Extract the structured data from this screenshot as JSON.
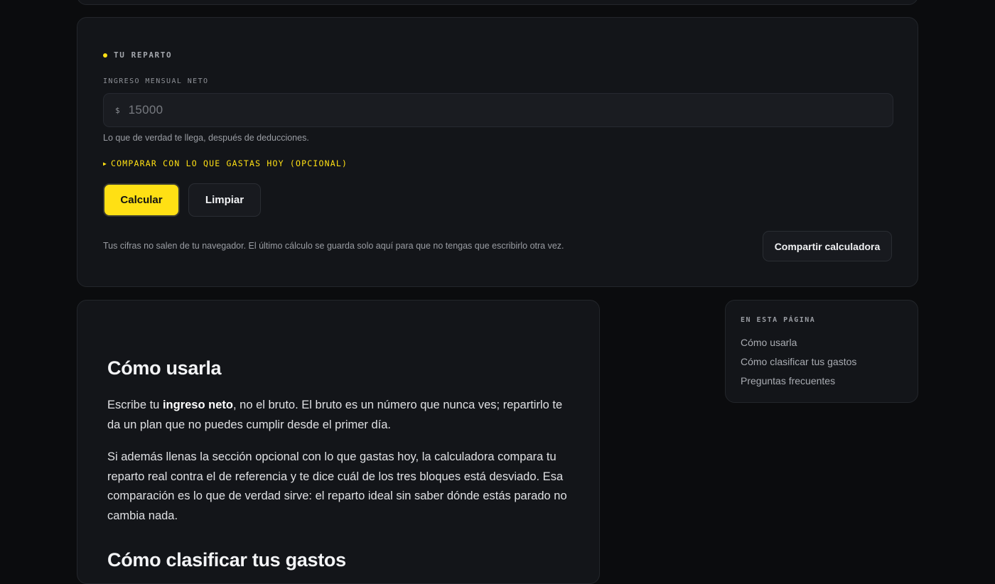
{
  "calculator": {
    "section_label": "TU REPARTO",
    "income_label": "INGRESO MENSUAL NETO",
    "currency_symbol": "$",
    "income_placeholder": "15000",
    "income_hint": "Lo que de verdad te llega, después de deducciones.",
    "compare_toggle": "COMPARAR CON LO QUE GASTAS HOY (OPCIONAL)",
    "calculate_label": "Calcular",
    "clear_label": "Limpiar",
    "privacy_note": "Tus cifras no salen de tu navegador. El último cálculo se guarda solo aquí para que no tengas que escribirlo otra vez.",
    "share_label": "Compartir calculadora"
  },
  "article": {
    "how_to_title": "Cómo usarla",
    "p1_before": "Escribe tu ",
    "p1_strong": "ingreso neto",
    "p1_after": ", no el bruto. El bruto es un número que nunca ves; repartirlo te da un plan que no puedes cumplir desde el primer día.",
    "p2": "Si además llenas la sección opcional con lo que gastas hoy, la calculadora compara tu reparto real contra el de referencia y te dice cuál de los tres bloques está desviado. Esa comparación es lo que de verdad sirve: el reparto ideal sin saber dónde estás parado no cambia nada.",
    "classify_title": "Cómo clasificar tus gastos"
  },
  "toc": {
    "title": "EN ESTA PÁGINA",
    "links": [
      "Cómo usarla",
      "Cómo clasificar tus gastos",
      "Preguntas frecuentes"
    ]
  },
  "colors": {
    "accent": "#ffe014",
    "background": "#0b0c0e",
    "card": "#131519"
  }
}
